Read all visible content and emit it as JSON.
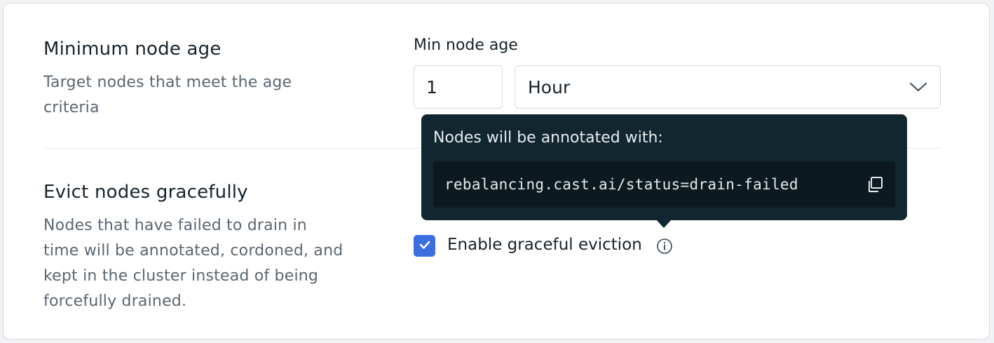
{
  "min_age_section": {
    "title": "Minimum node age",
    "description": "Target nodes that meet the age criteria",
    "field_label": "Min node age",
    "value": "1",
    "unit_selected": "Hour"
  },
  "evict_section": {
    "title": "Evict nodes gracefully",
    "description": "Nodes that have failed to drain in time will be annotated, cordoned, and kept in the cluster instead of being forcefully drained.",
    "checkbox_label": "Enable graceful eviction",
    "checkbox_checked": true
  },
  "tooltip": {
    "title": "Nodes will be annotated with:",
    "code": "rebalancing.cast.ai/status=drain-failed"
  },
  "icons": {
    "select_chevron": "chevron-down-icon",
    "copy": "copy-icon",
    "checkbox_check": "checkmark-icon",
    "info": "info-icon"
  },
  "colors": {
    "accent": "#3b6fe0",
    "tooltip_bg": "#12262f",
    "code_bg": "#0c1a20",
    "title_text": "#16222b",
    "muted_text": "#5b6670"
  }
}
